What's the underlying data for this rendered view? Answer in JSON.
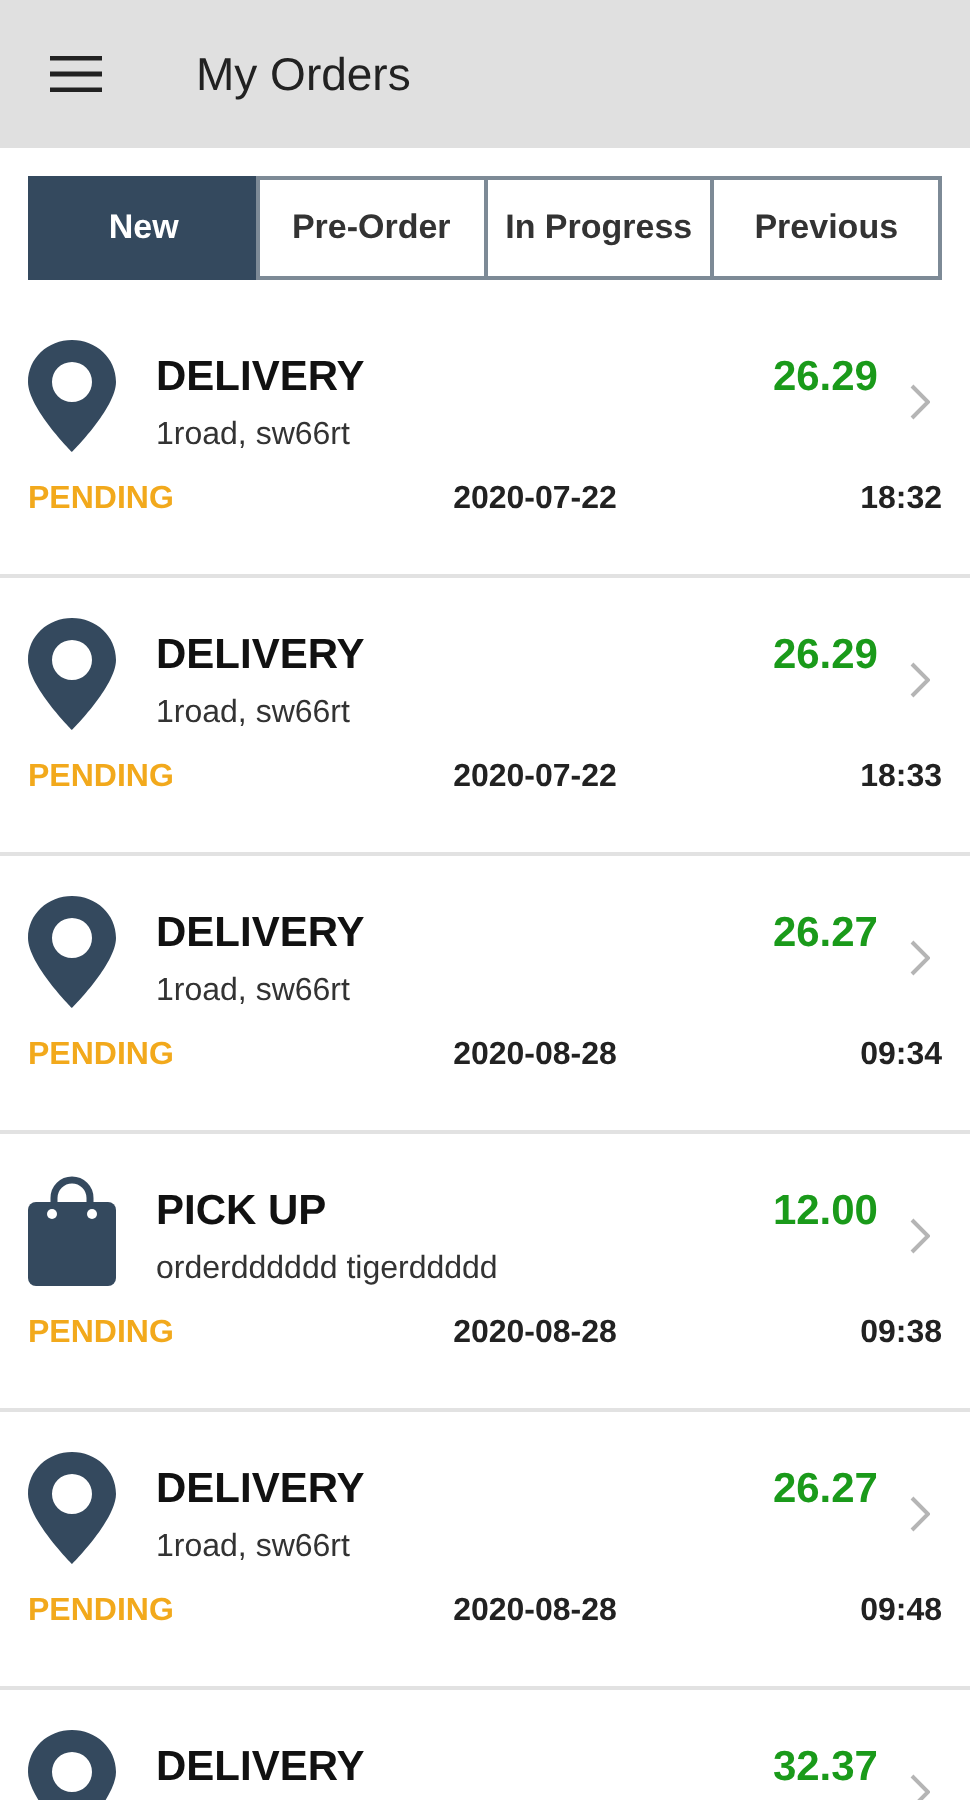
{
  "app_bar": {
    "title": "My Orders"
  },
  "tabs": [
    {
      "label": "New",
      "selected": true
    },
    {
      "label": "Pre-Order",
      "selected": false
    },
    {
      "label": "In Progress",
      "selected": false
    },
    {
      "label": "Previous",
      "selected": false
    }
  ],
  "orders": [
    {
      "kind": "delivery",
      "type": "DELIVERY",
      "address": "1road, sw66rt",
      "amount": "26.29",
      "status": "PENDING",
      "date": "2020-07-22",
      "time": "18:32"
    },
    {
      "kind": "delivery",
      "type": "DELIVERY",
      "address": "1road, sw66rt",
      "amount": "26.29",
      "status": "PENDING",
      "date": "2020-07-22",
      "time": "18:33"
    },
    {
      "kind": "delivery",
      "type": "DELIVERY",
      "address": "1road, sw66rt",
      "amount": "26.27",
      "status": "PENDING",
      "date": "2020-08-28",
      "time": "09:34"
    },
    {
      "kind": "pickup",
      "type": "PICK UP",
      "address": "orderdddddd tigerddddd",
      "amount": "12.00",
      "status": "PENDING",
      "date": "2020-08-28",
      "time": "09:38"
    },
    {
      "kind": "delivery",
      "type": "DELIVERY",
      "address": "1road, sw66rt",
      "amount": "26.27",
      "status": "PENDING",
      "date": "2020-08-28",
      "time": "09:48"
    },
    {
      "kind": "delivery",
      "type": "DELIVERY",
      "amount": "32.37"
    }
  ]
}
